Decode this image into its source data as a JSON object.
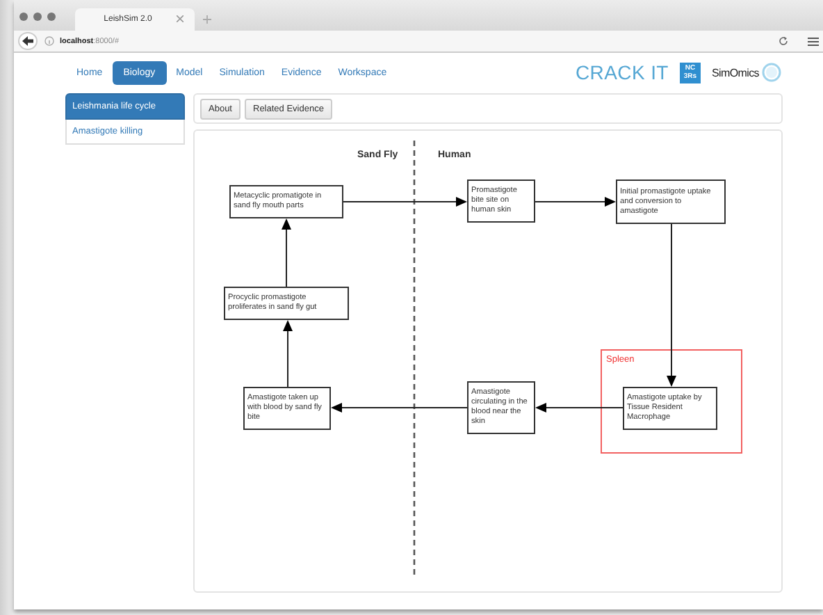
{
  "browser": {
    "tab_title": "LeishSim 2.0",
    "url_host": "localhost",
    "url_rest": ":8000/#"
  },
  "nav": [
    {
      "label": "Home",
      "selected": false
    },
    {
      "label": "Biology",
      "selected": true
    },
    {
      "label": "Model",
      "selected": false
    },
    {
      "label": "Simulation",
      "selected": false
    },
    {
      "label": "Evidence",
      "selected": false
    },
    {
      "label": "Workspace",
      "selected": false
    }
  ],
  "logos": {
    "crack_it": "CRACK IT",
    "nc3rs": "NC 3Rs",
    "simomics": "SimOmics"
  },
  "sidebar": {
    "items": [
      {
        "label": "Leishmania life cycle",
        "selected": true
      },
      {
        "label": "Amastigote killing",
        "selected": false
      }
    ]
  },
  "buttons": [
    "About",
    "Related Evidence"
  ],
  "diagram": {
    "lanes": [
      "Sand Fly",
      "Human"
    ],
    "regions": [
      {
        "label": "Spleen"
      }
    ],
    "nodes": [
      {
        "text": "Metacyclic promatigote in sand fly mouth parts"
      },
      {
        "text": "Promastigote bite site on human skin"
      },
      {
        "text": "Initial promastigote uptake and conversion to amastigote"
      },
      {
        "text": "Procyclic promastigote proliferates in sand fly gut"
      },
      {
        "text": "Amastigote taken up with blood by sand fly bite"
      },
      {
        "text": "Amastigote circulating in the blood near the skin"
      },
      {
        "text": "Amastigote uptake by Tissue Resident Macrophage"
      }
    ]
  }
}
